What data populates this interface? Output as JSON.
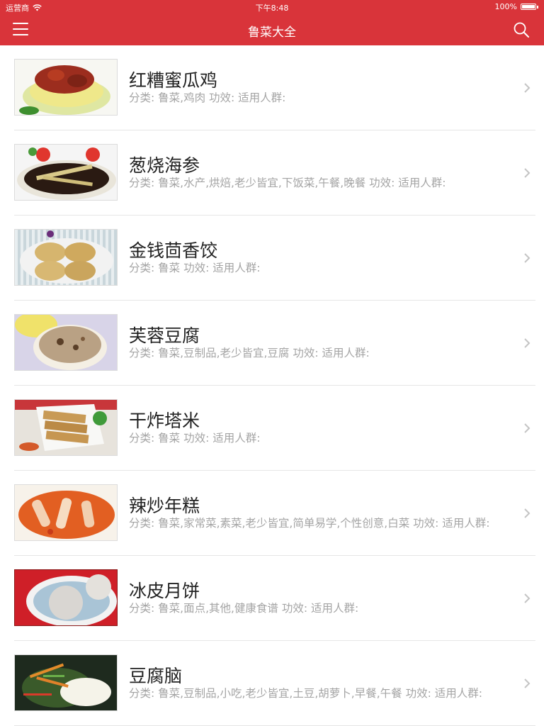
{
  "status": {
    "carrier": "运营商",
    "time": "下午8:48",
    "battery": "100%"
  },
  "nav": {
    "title": "鲁菜大全",
    "menu_icon": "hamburger-menu-icon",
    "search_icon": "search-icon"
  },
  "colors": {
    "brand": "#d9343a",
    "meta_text": "#a4a4a4",
    "title_text": "#222222"
  },
  "recipes": [
    {
      "title": "红糟蜜瓜鸡",
      "meta": "分类: 鲁菜,鸡肉   功效:    适用人群:"
    },
    {
      "title": "葱烧海参",
      "meta": "分类: 鲁菜,水产,烘焙,老少皆宜,下饭菜,午餐,晚餐   功效:    适用人群:"
    },
    {
      "title": "金钱茴香饺",
      "meta": "分类: 鲁菜   功效:    适用人群:"
    },
    {
      "title": "芙蓉豆腐",
      "meta": "分类: 鲁菜,豆制品,老少皆宜,豆腐   功效:    适用人群:"
    },
    {
      "title": "干炸塔米",
      "meta": "分类: 鲁菜   功效:    适用人群:"
    },
    {
      "title": "辣炒年糕",
      "meta": "分类: 鲁菜,家常菜,素菜,老少皆宜,简单易学,个性创意,白菜   功效:    适用人群:"
    },
    {
      "title": "冰皮月饼",
      "meta": "分类: 鲁菜,面点,其他,健康食谱   功效:    适用人群:"
    },
    {
      "title": "豆腐脑",
      "meta": "分类: 鲁菜,豆制品,小吃,老少皆宜,土豆,胡萝卜,早餐,午餐   功效:    适用人群:"
    }
  ]
}
